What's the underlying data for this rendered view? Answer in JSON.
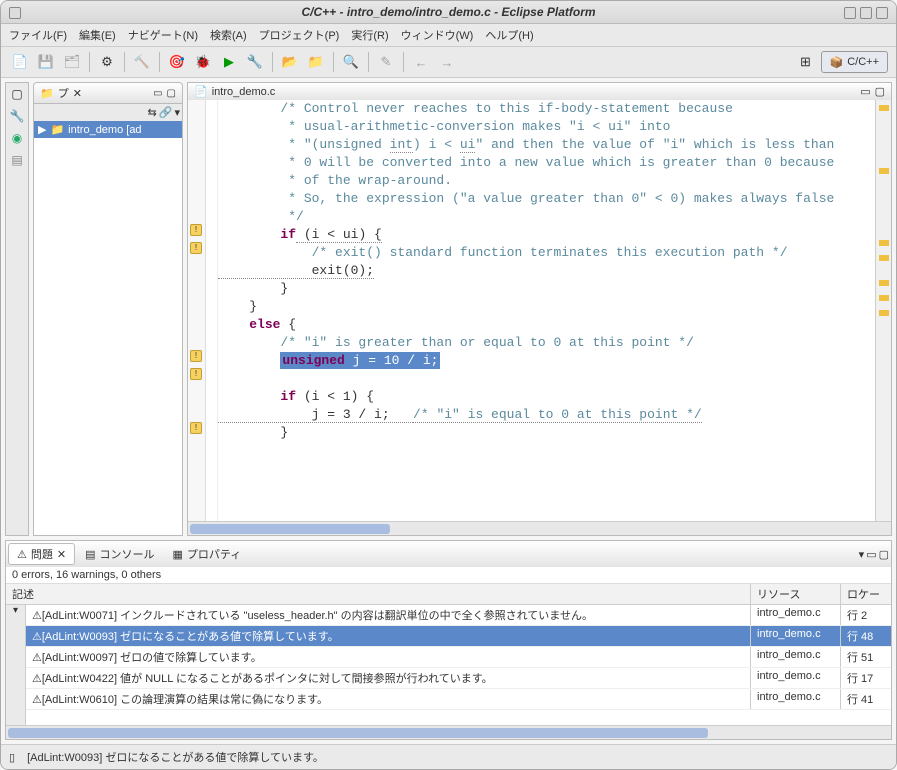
{
  "title": "C/C++ - intro_demo/intro_demo.c - Eclipse Platform",
  "menu": {
    "file": "ファイル(F)",
    "edit": "編集(E)",
    "navigate": "ナビゲート(N)",
    "search": "検索(A)",
    "project": "プロジェクト(P)",
    "run": "実行(R)",
    "window": "ウィンドウ(W)",
    "help": "ヘルプ(H)"
  },
  "perspective": {
    "label": "C/C++"
  },
  "project_explorer": {
    "tab_first": "プ",
    "close": "✕",
    "root": "intro_demo [ad"
  },
  "editor": {
    "tab": "intro_demo.c",
    "code": {
      "l1": "        /* Control never reaches to this if-body-statement because",
      "l2": "         * usual-arithmetic-conversion makes \"i < ui\" into",
      "l3a": "         * \"(unsigned ",
      "l3b": "int",
      "l3c": ") i < ",
      "l3d": "ui",
      "l3e": "\" and then the value of \"i\" which is less than",
      "l4": "         * 0 will be converted into a new value which is greater than 0 because",
      "l5": "         * of the wrap-around.",
      "l6": "         * So, the expression (\"a value greater than 0\" < 0) makes always false",
      "l7": "         */",
      "l8a": "        ",
      "l8b": "if",
      "l8c": " (i < ui) {",
      "l9": "            /* exit() standard function terminates this execution path */",
      "l10": "            exit(0);",
      "l11": "        }",
      "l12": "    }",
      "l13a": "    ",
      "l13b": "else",
      "l13c": " {",
      "l14": "        /* \"i\" is greater than or equal to 0 at this point */",
      "l15a": "        ",
      "l15b": "unsigned",
      "l15c": " j = 10 / i;",
      "l17a": "        ",
      "l17b": "if",
      "l17c": " (i < 1) {",
      "l18a": "            j = 3 / i;   ",
      "l18b": "/* \"i\" is equal to 0 at this point */",
      "l19": "        }"
    }
  },
  "problems": {
    "tab_problems": "問題",
    "tab_console": "コンソール",
    "tab_properties": "プロパティ",
    "summary": "0 errors, 16 warnings, 0 others",
    "headers": {
      "desc": "記述",
      "resource": "リソース",
      "loc": "ロケー"
    },
    "rows": [
      {
        "desc": "[AdLint:W0071] インクルードされている \"useless_header.h\" の内容は翻訳単位の中で全く参照されていません。",
        "res": "intro_demo.c",
        "loc": "行 2"
      },
      {
        "desc": "[AdLint:W0093] ゼロになることがある値で除算しています。",
        "res": "intro_demo.c",
        "loc": "行 48"
      },
      {
        "desc": "[AdLint:W0097] ゼロの値で除算しています。",
        "res": "intro_demo.c",
        "loc": "行 51"
      },
      {
        "desc": "[AdLint:W0422] 値が NULL になることがあるポインタに対して間接参照が行われています。",
        "res": "intro_demo.c",
        "loc": "行 17"
      },
      {
        "desc": "[AdLint:W0610] この論理演算の結果は常に偽になります。",
        "res": "intro_demo.c",
        "loc": "行 41"
      }
    ]
  },
  "status": {
    "msg": "[AdLint:W0093] ゼロになることがある値で除算しています。"
  }
}
